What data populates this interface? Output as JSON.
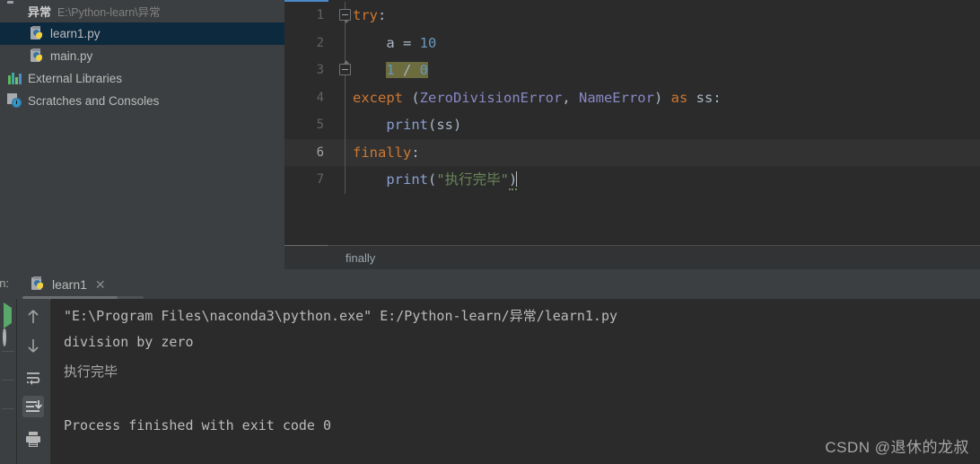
{
  "project_tree": {
    "rows": [
      {
        "icon": "folder-icon",
        "name": "异常",
        "path": "E:\\Python-learn\\异常",
        "selected": false,
        "indent": 0,
        "kind": "project-root"
      },
      {
        "icon": "python-file-icon",
        "name": "learn1.py",
        "path": "",
        "selected": true,
        "indent": 1,
        "kind": "file"
      },
      {
        "icon": "python-file-icon",
        "name": "main.py",
        "path": "",
        "selected": false,
        "indent": 1,
        "kind": "file"
      },
      {
        "icon": "external-libraries-icon",
        "name": "External Libraries",
        "path": "",
        "selected": false,
        "indent": 0,
        "kind": "node"
      },
      {
        "icon": "scratches-icon",
        "name": "Scratches and Consoles",
        "path": "",
        "selected": false,
        "indent": 0,
        "kind": "node"
      }
    ]
  },
  "editor": {
    "lines": [
      {
        "num": "1",
        "fold": "open",
        "current": false
      },
      {
        "num": "2",
        "fold": "none",
        "current": false
      },
      {
        "num": "3",
        "fold": "end",
        "current": false
      },
      {
        "num": "4",
        "fold": "none",
        "current": false
      },
      {
        "num": "5",
        "fold": "none",
        "current": false
      },
      {
        "num": "6",
        "fold": "none",
        "current": true
      },
      {
        "num": "7",
        "fold": "none",
        "current": false
      }
    ],
    "code": {
      "l1_try": "try",
      "l1_colon": ":",
      "l2_a": "a",
      "l2_eq": " = ",
      "l2_10": "10",
      "l3_1": "1",
      "l3_slash": " / ",
      "l3_0": "0",
      "l4_except": "except",
      "l4_paren_open": " (",
      "l4_exc1": "ZeroDivisionError",
      "l4_comma": ", ",
      "l4_exc2": "NameError",
      "l4_paren_close": ") ",
      "l4_as": "as",
      "l4_ss": " ss:",
      "l5_print": "print",
      "l5_args": "(ss)",
      "l6_finally": "finally",
      "l6_colon": ":",
      "l7_print": "print",
      "l7_open": "(",
      "l7_str": "\"执行完毕\"",
      "l7_close": ")"
    },
    "breadcrumb": "finally"
  },
  "run_panel": {
    "label": "un:",
    "tab_label": "learn1",
    "tab_close": "✕",
    "toolbar": [
      {
        "name": "rerun-icon"
      },
      {
        "name": "stop-icon"
      },
      {
        "name": "settings-icon"
      },
      {
        "name": "pin-icon"
      },
      {
        "name": "up-arrow-icon"
      },
      {
        "name": "down-arrow-icon"
      },
      {
        "name": "soft-wrap-icon"
      },
      {
        "name": "scroll-to-end-icon"
      },
      {
        "name": "print-icon"
      }
    ],
    "console_lines": [
      {
        "text": "\"E:\\Program Files\\naconda3\\python.exe\" E:/Python-learn/异常/learn1.py",
        "cn": false
      },
      {
        "text": "division by zero",
        "cn": false
      },
      {
        "text": "执行完毕",
        "cn": true
      },
      {
        "text": "",
        "cn": false
      },
      {
        "text": "Process finished with exit code 0",
        "cn": false
      }
    ]
  },
  "watermark": "CSDN @退休的龙叔",
  "colors": {
    "editor_bg": "#2b2b2b",
    "panel_bg": "#3c3f41",
    "selection_blue": "#0d293e",
    "keyword_orange": "#cc7832",
    "class_purple": "#8888c6",
    "number_blue": "#6897bb",
    "string_green": "#6a8759",
    "text_grey": "#a9b7c6",
    "highlight_olive": "#6c6c3f"
  }
}
